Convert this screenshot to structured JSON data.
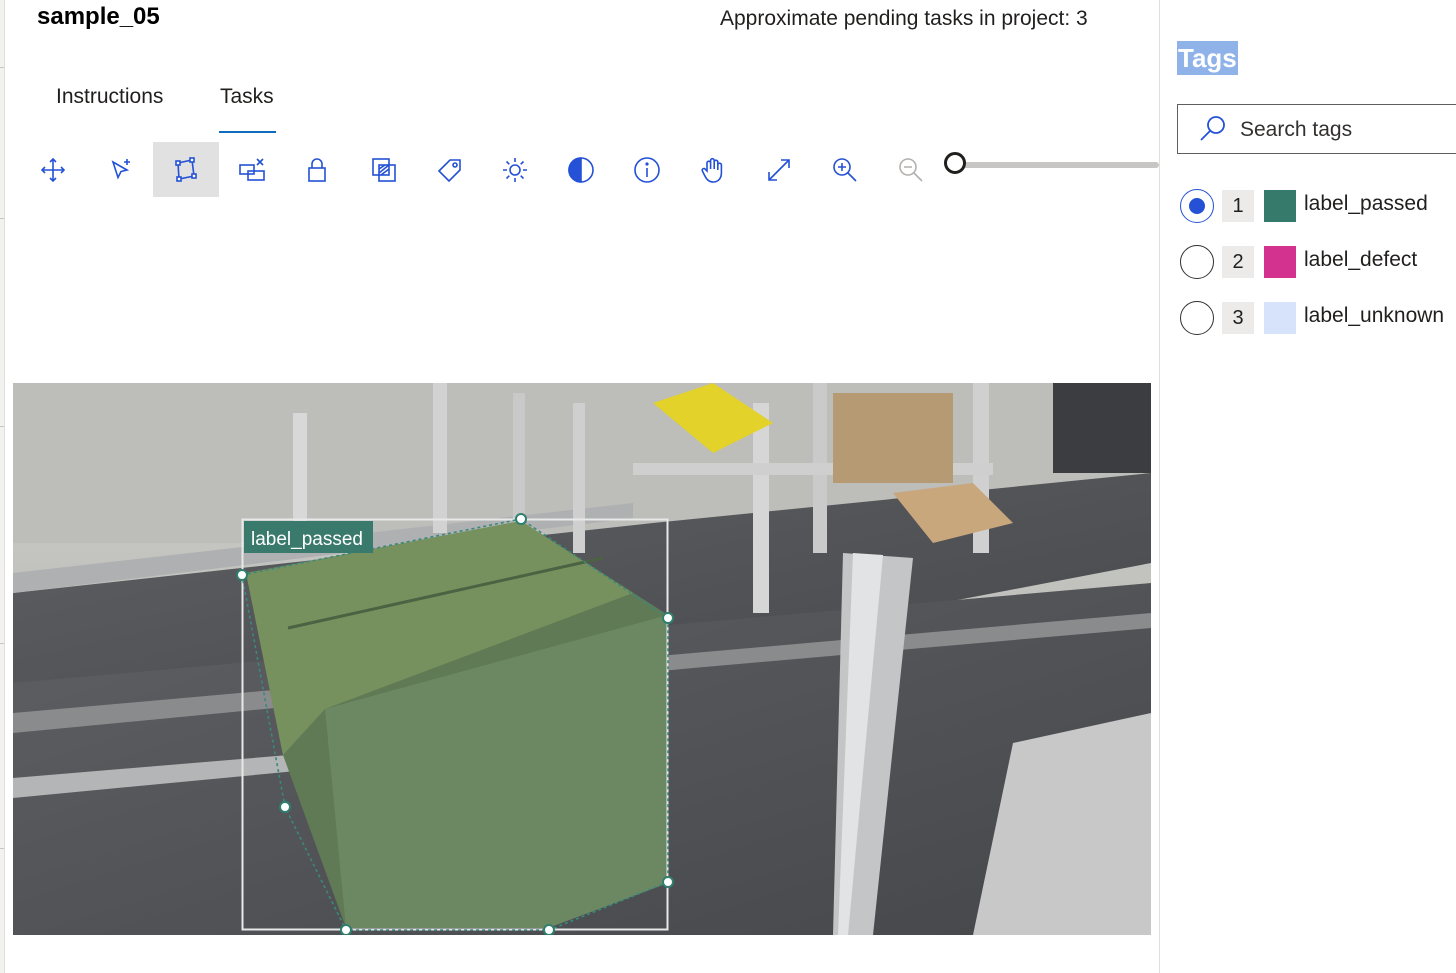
{
  "header": {
    "sample_name": "sample_05",
    "pending_text": "Approximate pending tasks in project: 3"
  },
  "tabs": [
    {
      "label": "Instructions",
      "active": false
    },
    {
      "label": "Tasks",
      "active": true
    }
  ],
  "toolbar": {
    "tools": [
      {
        "icon": "move-icon",
        "selected": false
      },
      {
        "icon": "pointer-add-icon",
        "selected": false
      },
      {
        "icon": "polygon-icon",
        "selected": true
      },
      {
        "icon": "region-remove-icon",
        "selected": false
      },
      {
        "icon": "lock-icon",
        "selected": false
      },
      {
        "icon": "regions-overlap-icon",
        "selected": false
      },
      {
        "icon": "tag-icon",
        "selected": false
      },
      {
        "icon": "brightness-icon",
        "selected": false
      },
      {
        "icon": "contrast-icon",
        "selected": false
      },
      {
        "icon": "info-icon",
        "selected": false
      },
      {
        "icon": "hand-pan-icon",
        "selected": false
      },
      {
        "icon": "fit-expand-icon",
        "selected": false
      },
      {
        "icon": "zoom-in-icon",
        "selected": false
      },
      {
        "icon": "zoom-out-icon",
        "selected": false
      }
    ],
    "zoom_level": 0
  },
  "canvas": {
    "region_label": "label_passed",
    "region_color": "#3a7a6c"
  },
  "sidebar": {
    "title": "Tags",
    "search_placeholder": "Search tags",
    "tags": [
      {
        "number": "1",
        "name": "label_passed",
        "color": "#357a6b",
        "selected": true
      },
      {
        "number": "2",
        "name": "label_defect",
        "color": "#d3338f",
        "selected": false
      },
      {
        "number": "3",
        "name": "label_unknown",
        "color": "#d6e3fa",
        "selected": false
      }
    ]
  },
  "colors": {
    "accent": "#0f6cbd",
    "radio_selected": "#2451d6",
    "title_highlight": "#8fb2e8"
  }
}
